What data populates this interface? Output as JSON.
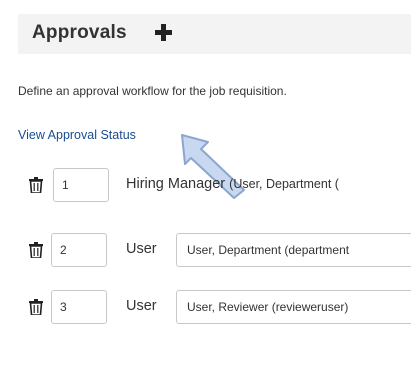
{
  "header": {
    "title": "Approvals"
  },
  "description": "Define an approval workflow for the job requisition.",
  "status_link": "View Approval Status",
  "colors": {
    "link": "#1a4d8f",
    "arrow": "#c7d8f0",
    "header_bg": "#f3f3f3"
  },
  "approvers": [
    {
      "order": "1",
      "type": "Hiring Manager",
      "detail": "(User, Department ("
    },
    {
      "order": "2",
      "type": "User",
      "value": "User, Department (department"
    },
    {
      "order": "3",
      "type": "User",
      "value": "User, Reviewer (revieweruser)"
    }
  ]
}
